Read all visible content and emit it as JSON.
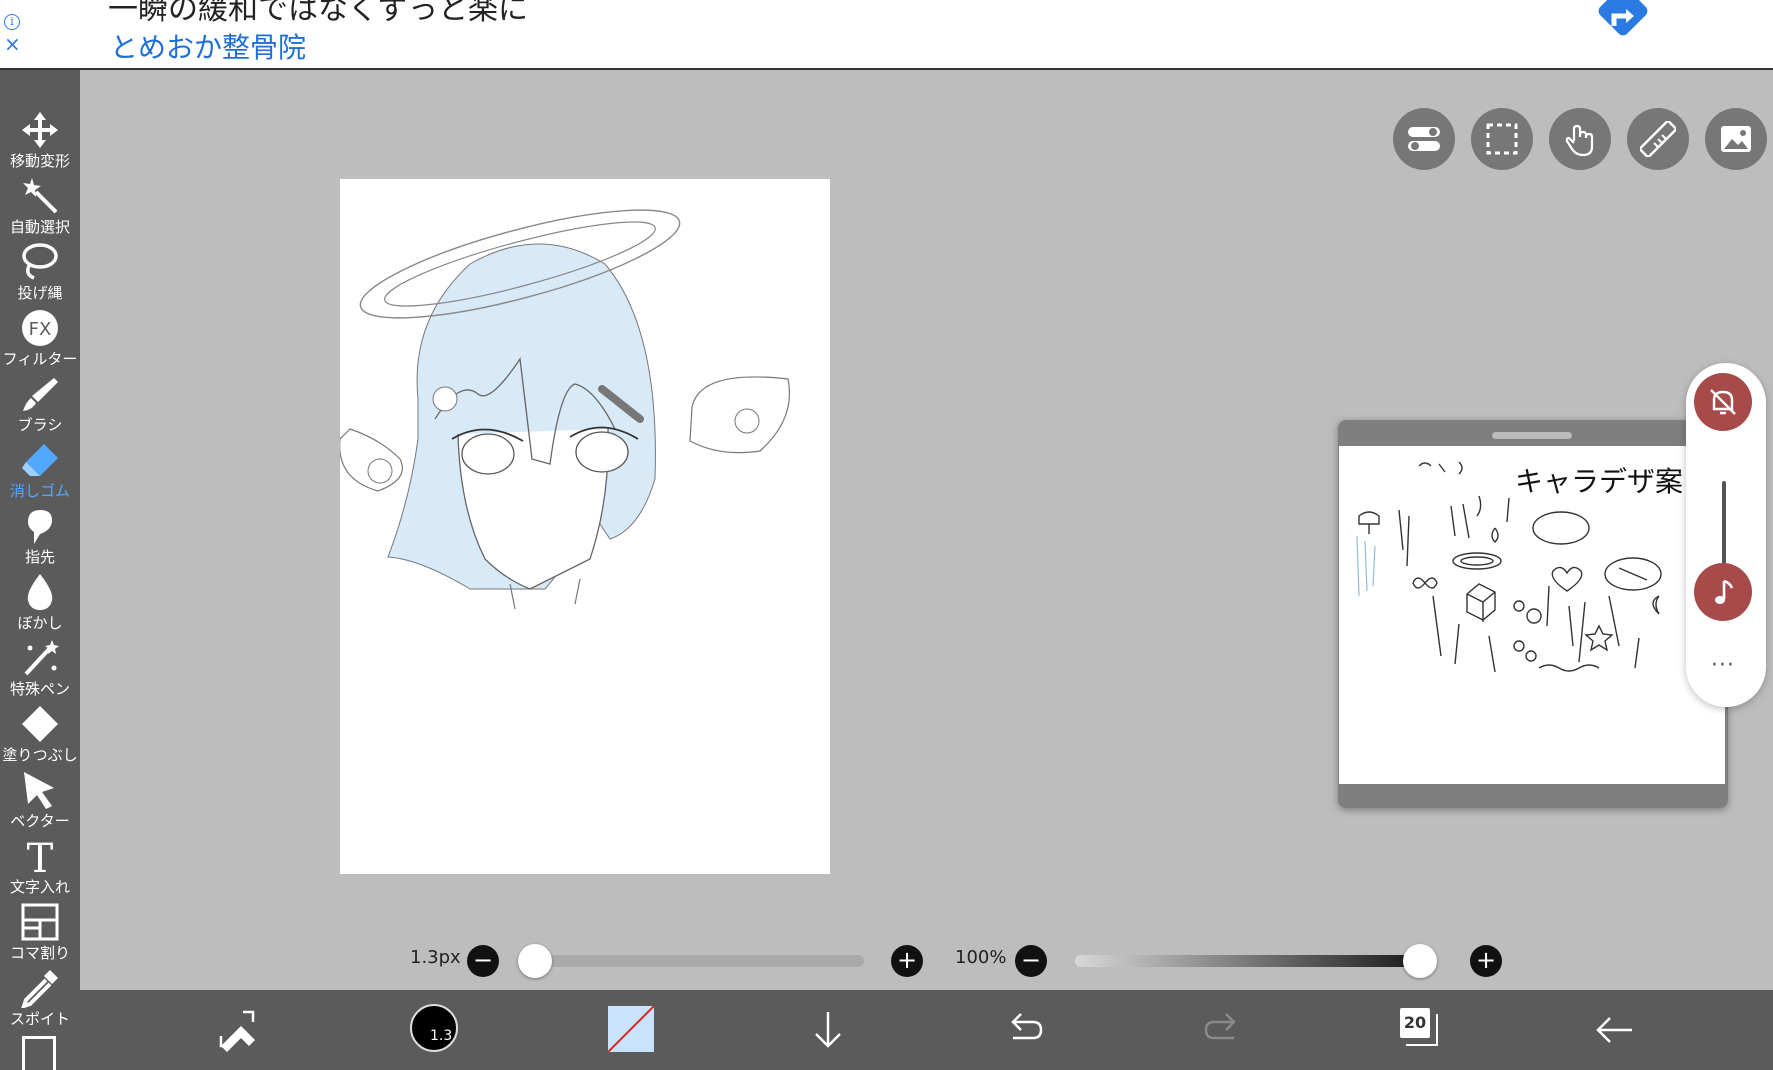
{
  "ad": {
    "headline": "一瞬の緩和ではなくずっと楽に",
    "advertiser": "とめおか整骨院",
    "info_icon": "info-icon",
    "close_icon": "close-icon",
    "go_icon": "turn-right-arrow-icon"
  },
  "left_toolbar": {
    "items": [
      {
        "label": "移動変形",
        "icon": "move-icon"
      },
      {
        "label": "自動選択",
        "icon": "magic-wand-icon"
      },
      {
        "label": "投げ縄",
        "icon": "lasso-icon"
      },
      {
        "label": "フィルター",
        "icon": "fx-icon",
        "icon_text": "FX"
      },
      {
        "label": "ブラシ",
        "icon": "brush-icon"
      },
      {
        "label": "消しゴム",
        "icon": "eraser-icon",
        "active": true
      },
      {
        "label": "指先",
        "icon": "finger-smudge-icon"
      },
      {
        "label": "ぼかし",
        "icon": "blur-drop-icon"
      },
      {
        "label": "特殊ペン",
        "icon": "special-pen-icon"
      },
      {
        "label": "塗りつぶし",
        "icon": "fill-bucket-icon"
      },
      {
        "label": "ベクター",
        "icon": "vector-cursor-icon"
      },
      {
        "label": "文字入れ",
        "icon": "text-icon",
        "icon_text": "T"
      },
      {
        "label": "コマ割り",
        "icon": "frame-divide-icon"
      },
      {
        "label": "スポイト",
        "icon": "eyedropper-icon"
      }
    ],
    "active_color": "#52a8ff"
  },
  "top_right_tools": [
    "toggle-icon",
    "selection-icon",
    "hand-icon",
    "ruler-icon",
    "image-icon"
  ],
  "reference_window": {
    "title": "キャラデザ案"
  },
  "recording_overlay": {
    "mute_icon": "bell-off-icon",
    "music_icon": "music-note-icon",
    "more": "···",
    "accent": "#a64a4a"
  },
  "brush_size": {
    "value": "1.3px",
    "fraction": 0.0
  },
  "opacity": {
    "value": "100%",
    "fraction": 1.0
  },
  "bottom_bar": {
    "brush_badge": "1.3",
    "layer_count": "20",
    "icons": [
      "tool-swap-icon",
      "brush-size-icon",
      "color-swatch-icon",
      "download-arrow-icon",
      "undo-icon",
      "redo-icon",
      "layers-icon",
      "back-arrow-icon"
    ]
  }
}
